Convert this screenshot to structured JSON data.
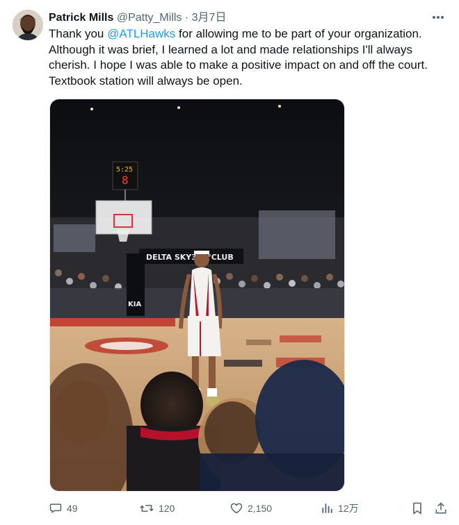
{
  "tweet": {
    "author": {
      "name": "Patrick Mills",
      "handle": "@Patty_Mills"
    },
    "separator": "·",
    "date": "3月7日",
    "text": {
      "part1": "Thank you ",
      "mention": "@ATLHawks",
      "part2": " for allowing me to be part of your organization. Although it was brief, I learned a lot and made relationships I'll always cherish. I hope I was able to make a positive impact on and off the court. Textbook station will always be open."
    },
    "media": {
      "banner": "DELTA SKY360°CLUB",
      "shot_clock": "8",
      "game_clock": "5:25",
      "sponsor": "KIA"
    },
    "actions": {
      "replies": "49",
      "reposts": "120",
      "likes": "2,150",
      "views": "12万"
    }
  },
  "colors": {
    "link": "#1d9bf0",
    "secondary_text": "#536471",
    "primary_text": "#0f1419"
  }
}
